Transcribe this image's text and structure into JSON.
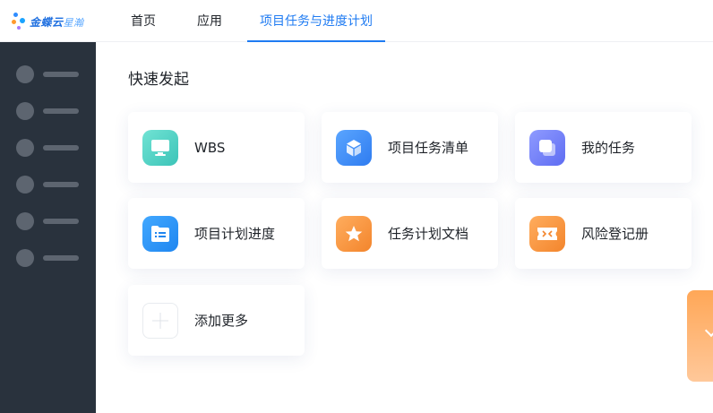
{
  "app": {
    "brand": "金蝶云",
    "brand_sub": "星瀚"
  },
  "nav": {
    "home": "首页",
    "apps": "应用",
    "active_tab": "项目任务与进度计划"
  },
  "sidebar": {
    "items": [
      "item-1",
      "item-2",
      "item-3",
      "item-4",
      "item-5",
      "item-6"
    ]
  },
  "main": {
    "section_title": "快速发起",
    "cards": [
      {
        "label": "WBS",
        "icon": "monitor-icon",
        "color": "#3cc4b8"
      },
      {
        "label": "项目任务清单",
        "icon": "cube-icon",
        "color": "#2f7cf0"
      },
      {
        "label": "我的任务",
        "icon": "stacked-square-icon",
        "color": "#5e6cf2"
      },
      {
        "label": "项目计划进度",
        "icon": "folder-list-icon",
        "color": "#1f86f0"
      },
      {
        "label": "任务计划文档",
        "icon": "star-icon",
        "color": "#f3852c"
      },
      {
        "label": "风险登记册",
        "icon": "ticket-icon",
        "color": "#f3852c"
      },
      {
        "label": "添加更多",
        "icon": "plus-icon",
        "color": "#e8ebef"
      }
    ]
  },
  "colors": {
    "accent": "#1f7bf2",
    "sidebar_bg": "#29323d",
    "float_tab": "#ffa757"
  }
}
